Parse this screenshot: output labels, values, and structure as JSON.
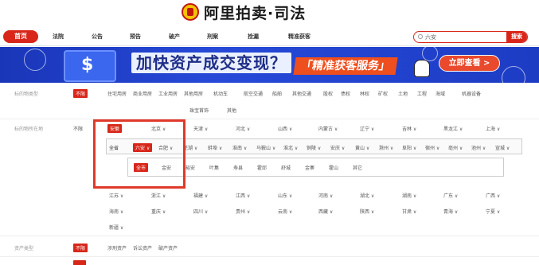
{
  "logo": {
    "text": "阿里拍卖·司法",
    "emblem_icon": "court-emblem-icon"
  },
  "nav": {
    "home": "首页",
    "items": [
      "法院",
      "公告",
      "预告",
      "破产",
      "刑案",
      "捡漏",
      "精准获客"
    ]
  },
  "search": {
    "value": "六安",
    "button": "搜索"
  },
  "banner": {
    "title": "加快资产成交变现？",
    "slogan": "「精准获客服务」",
    "cta": "立即查看 >"
  },
  "filters": {
    "type": {
      "label": "标的物类型",
      "items": [
        "不限",
        "住宅用房",
        "商业用房",
        "工业用房",
        "其他用房",
        "机动车",
        "航空交通",
        "船舶",
        "其他交通",
        "股权",
        "债权",
        "林权",
        "矿权",
        "土地",
        "工程",
        "海域",
        "机器设备"
      ],
      "items2": [
        "珠宝首饰",
        "其他"
      ]
    },
    "location": {
      "label": "标的物所在地",
      "unlimited": "不限",
      "provinces_row1": [
        "安徽",
        "北京 ∨",
        "天津 ∨",
        "河北 ∨",
        "山西 ∨",
        "内蒙古 ∨",
        "辽宁 ∨",
        "吉林 ∨",
        "黑龙江 ∨",
        "上海 ∨"
      ],
      "province_all": "全省",
      "cities": [
        "六安 ∨",
        "合肥 ∨",
        "芜湖 ∨",
        "蚌埠 ∨",
        "淮南 ∨",
        "马鞍山 ∨",
        "淮北 ∨",
        "铜陵 ∨",
        "安庆 ∨",
        "黄山 ∨",
        "滁州 ∨",
        "阜阳 ∨",
        "宿州 ∨",
        "亳州 ∨",
        "池州 ∨",
        "宣城 ∨"
      ],
      "district_all": "全市",
      "districts": [
        "金安",
        "裕安",
        "叶集",
        "寿县",
        "霍邱",
        "舒城",
        "金寨",
        "霍山",
        "其它"
      ],
      "provinces_row2": [
        "江苏 ∨",
        "浙江 ∨",
        "福建 ∨",
        "江西 ∨",
        "山东 ∨",
        "河南 ∨",
        "湖北 ∨",
        "湖南 ∨",
        "广东 ∨",
        "广西 ∨"
      ],
      "provinces_row3": [
        "海南 ∨",
        "重庆 ∨",
        "四川 ∨",
        "贵州 ∨",
        "云南 ∨",
        "西藏 ∨",
        "陕西 ∨",
        "甘肃 ∨",
        "青海 ∨",
        "宁夏 ∨"
      ],
      "provinces_row4": [
        "新疆 ∨"
      ]
    },
    "asset": {
      "label": "资产类型",
      "items": [
        "不限",
        "涉刑资产",
        "诉讼资产",
        "破产资产"
      ]
    }
  },
  "colors": {
    "brand": "#d8261a",
    "highlight": "#e0392a"
  }
}
